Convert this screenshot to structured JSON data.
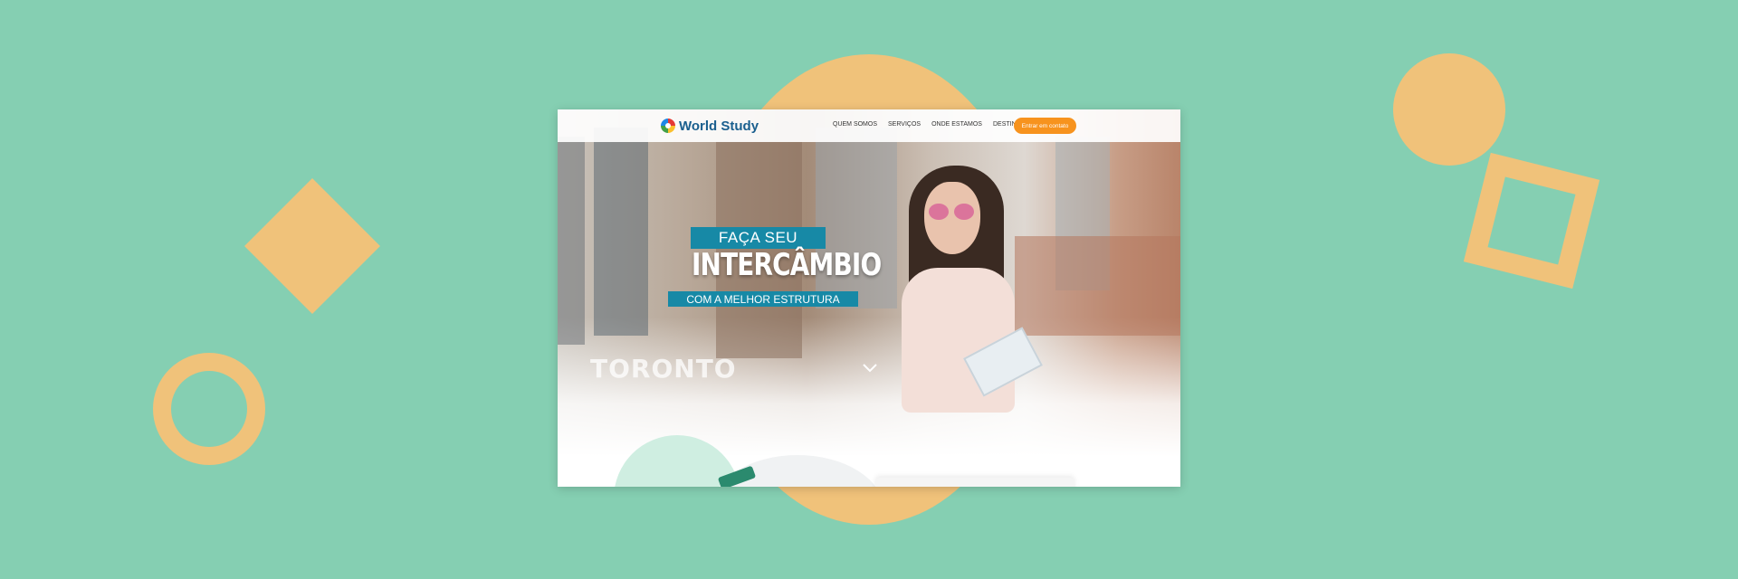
{
  "site": {
    "logo_text": "World Study",
    "nav": [
      "QUEM SOMOS",
      "SERVIÇOS",
      "ONDE ESTAMOS",
      "DESTINOS"
    ],
    "cta_label": "Entrar em contato",
    "hero": {
      "tag_top": "FAÇA SEU",
      "title": "INTERCÂMBIO",
      "tag_bottom": "COM A MELHOR ESTRUTURA"
    },
    "sign_text": "TORONTO"
  },
  "colors": {
    "background": "#85cfb2",
    "accent_shapes": "#f0c27a",
    "brand_blue": "#1789a6",
    "cta_orange": "#f7931e"
  },
  "icons": {
    "logo": "globe-logo-icon",
    "scroll": "chevron-down-icon"
  }
}
